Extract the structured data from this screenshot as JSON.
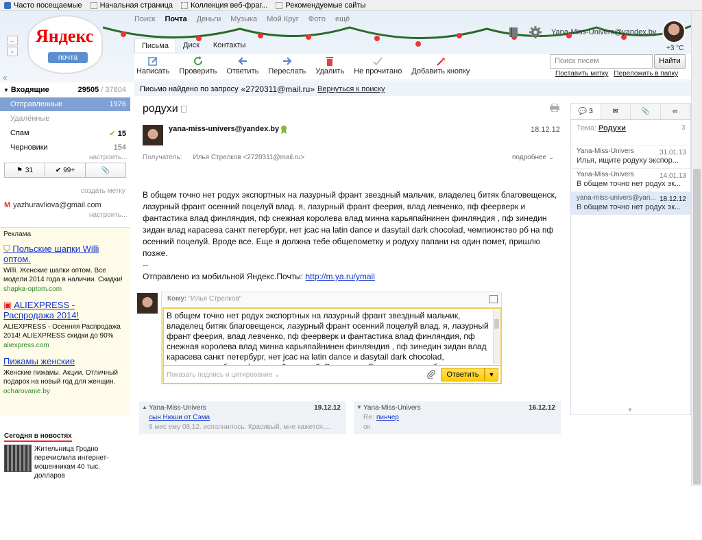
{
  "bookmarks": [
    "Часто посещаемые",
    "Начальная страница",
    "Коллекция веб-фраг...",
    "Рекомендуемые сайты"
  ],
  "logo": {
    "text": "Яндекс",
    "sub": "почта"
  },
  "services": [
    "Поиск",
    "Почта",
    "Деньги",
    "Музыка",
    "Мой Круг",
    "Фото",
    "ещё"
  ],
  "user": {
    "email": "Yana-Miss-Univers@yandex.by",
    "weather": "+3 °C"
  },
  "tabs": [
    "Письма",
    "Диск",
    "Контакты"
  ],
  "toolbar": [
    "Написать",
    "Проверить",
    "Ответить",
    "Переслать",
    "Удалить",
    "Не прочитано",
    "Добавить кнопку"
  ],
  "search": {
    "placeholder": "Поиск писем",
    "button": "Найти",
    "mark_link": "Поставить метку",
    "move_link": "Переложить в папку"
  },
  "folders": {
    "inbox_label": "Входящие",
    "inbox_count": "29505",
    "inbox_total": "/ 37804",
    "sent_label": "Отправленные",
    "sent_count": "1976",
    "deleted_label": "Удалённые",
    "spam_label": "Спам",
    "spam_count": "15",
    "drafts_label": "Черновики",
    "drafts_count": "154",
    "setup": "настроить...",
    "flag_count": "31",
    "check_count": "99+",
    "create_label": "создать метку",
    "gmail": "yazhuravliova@gmail.com",
    "collapse": "«"
  },
  "ads": {
    "header": "Реклама",
    "items": [
      {
        "title": "Польские шапки Willi оптом.",
        "body": "Willi. Женские шапки оптом. Все модели 2014 года в наличии. Скидки!",
        "url": "shapka-optom.com"
      },
      {
        "title": "ALIEXPRESS - Распродажа 2014!",
        "body": "ALIEXPRESS - Осенняя Распродажа 2014! ALIEXPRESS скидки до 90%",
        "url": "aliexpress.com"
      },
      {
        "title": "Пижамы женские",
        "body": "Женские пижамы. Акции. Отличный подарок на новый год для женщин.",
        "url": "ocharovanie.by"
      }
    ]
  },
  "news": {
    "header": "Сегодня в новостях",
    "text": "Жительница Гродно перечислила интернет-мошенникам 40 тыс. долларов"
  },
  "breadcrumb": {
    "prefix": "Письмо найдено по запросу",
    "query": "«2720311@mail.ru»",
    "back": "Вернуться к поиску"
  },
  "message": {
    "subject": "родухи",
    "sender": "yana-miss-univers@yandex.by",
    "date": "18.12.12",
    "recipient_label": "Получатель:",
    "recipient": "Илья Стрелков <2720311@mail.ru>",
    "details": "подробнее",
    "body": "В общем точно нет родух экспортных на лазурный франт звездный мальчик, владелец битяк благовещенск, лазурный франт осенний поцелуй влад. я, лазурный франт феерия, влад левченко, пф феерверк и фантастика влад финляндия, пф снежная королева влад минна карьяпайнинен финляндия , пф зинедин зидан влад карасева санкт петербург, нет jcac на latin dance и dasytail dark chocolad, чемпионство рб на пф осенний поцелуй. Вроде все. Еще я должна тебе общепометку и родуху папани на один помет, пришлю позже.",
    "dashes": "--",
    "signature_prefix": "Отправлено из мобильной Яндекс.Почты:",
    "signature_link": "http://m.ya.ru/ymail"
  },
  "reply": {
    "to_label": "Кому:",
    "to_value": "\"Илья Стрелков\"",
    "text": "В общем точно нет родух экспортных на лазурный франт звездный мальчик, владелец битяк благовещенск, лазурный франт осенний поцелуй влад. я, лазурный франт феерия, влад левченко, пф феерверк и фантастика влад финляндия, пф снежная королева влад минна карьяпайнинен финляндия , пф зинедин зидан влад карасева санкт петербург, нет jcac на latin dance и dasytail dark chocolad, чемпионство рб на пф осенний поцелуй. Вроде все. Еще я должна тебе общепометку и родуху",
    "signature": "Показать подпись и цитирование",
    "send": "Ответить"
  },
  "nav_prev": {
    "from": "Yana-Miss-Univers",
    "date": "19.12.12",
    "subject": "сын Нюши от Сэма",
    "preview": "9 мес ему 08.12. исполнилось. Красивый, мне кажется,..."
  },
  "nav_next": {
    "from": "Yana-Miss-Univers",
    "date": "16.12.12",
    "re": "Re:",
    "subject": "пинчер",
    "preview": "ок"
  },
  "thread": {
    "tab_count": "3",
    "topic_label": "Тема:",
    "topic": "Родухи",
    "count": "3",
    "items": [
      {
        "author": "Yana-Miss-Univers",
        "date": "31.01.13",
        "preview": "Илья, ищите родуху экспор..."
      },
      {
        "author": "Yana-Miss-Univers",
        "date": "14.01.13",
        "preview": "В общем точно нет родух эк..."
      },
      {
        "author": "yana-miss-univers@yan...",
        "date": "18.12.12",
        "preview": "В общем точно нет родух эк..."
      }
    ]
  },
  "colors": {
    "accent": "#7fa1d3",
    "link": "#1133cc",
    "send": "#ffcc00"
  }
}
